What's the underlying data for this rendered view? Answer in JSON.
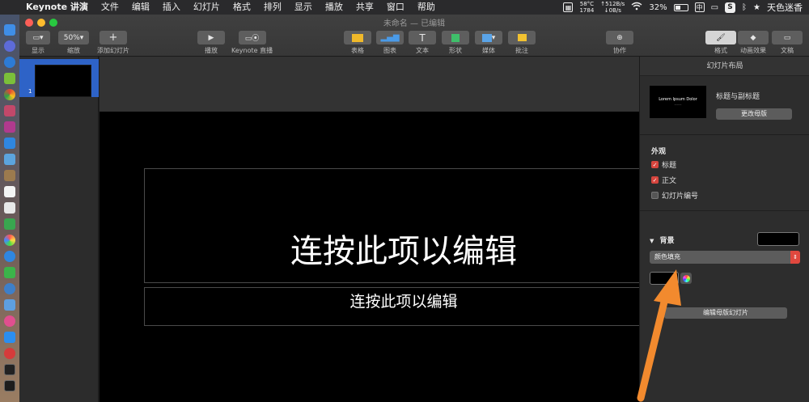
{
  "menubar": {
    "app_name": "Keynote 讲演",
    "items": [
      "文件",
      "编辑",
      "插入",
      "幻灯片",
      "格式",
      "排列",
      "显示",
      "播放",
      "共享",
      "窗口",
      "帮助"
    ],
    "status": {
      "cpu_temp": "58°C",
      "cpu_val": "1784",
      "net_up": "↑512B/s",
      "net_down": "↓0B/s",
      "battery": "32%",
      "input_method": "中",
      "user": "天色迷香"
    }
  },
  "window": {
    "title": "未命名 — 已编辑",
    "toolbar": {
      "view_label": "显示",
      "zoom_value": "50%",
      "zoom_label": "缩放",
      "add_slide_label": "添加幻灯片",
      "play_label": "播放",
      "keynote_live_label": "Keynote 直播",
      "table_label": "表格",
      "chart_label": "图表",
      "text_label": "文本",
      "shape_label": "形状",
      "media_label": "媒体",
      "comment_label": "批注",
      "collaborate_label": "协作",
      "format_label": "格式",
      "animate_label": "动画效果",
      "document_label": "文稿"
    }
  },
  "navigator": {
    "slides": [
      {
        "number": "1"
      }
    ]
  },
  "slide": {
    "title_placeholder": "连按此项以编辑",
    "subtitle_placeholder": "连按此项以编辑"
  },
  "inspector": {
    "header": "幻灯片布局",
    "layout_name": "标题与副标题",
    "layout_thumb_text": "Lorem Ipsum Dolor",
    "change_master_label": "更改母版",
    "appearance_label": "外观",
    "appearance_options": [
      {
        "label": "标题",
        "checked": true
      },
      {
        "label": "正文",
        "checked": true
      },
      {
        "label": "幻灯片编号",
        "checked": false
      }
    ],
    "background_label": "背景",
    "fill_type": "颜色填充",
    "edit_master_label": "编辑母版幻灯片",
    "background_color": "#000000"
  },
  "colors": {
    "accent_selection": "#2e63c7",
    "arrow": "#f28a2e",
    "checkbox_on": "#d6453e"
  }
}
